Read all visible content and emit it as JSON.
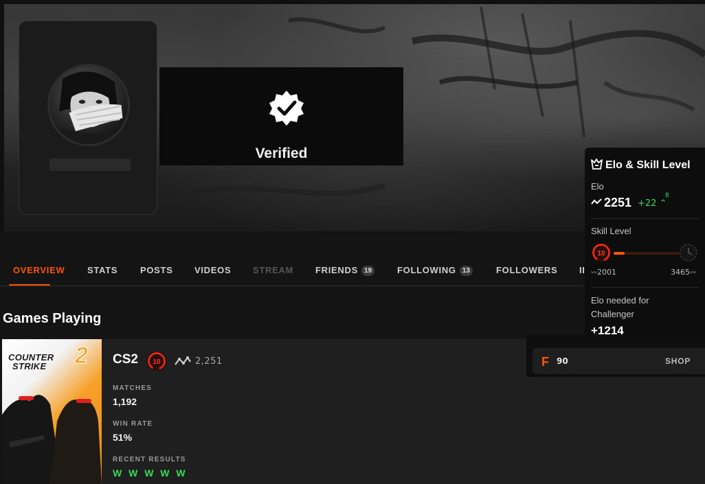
{
  "profile": {
    "verified_label": "Verified",
    "avatar_icon": "user-avatar",
    "verified_icon": "verified-badge-icon"
  },
  "tabs": [
    {
      "label": "OVERVIEW",
      "badge": "",
      "state": "active"
    },
    {
      "label": "STATS",
      "badge": "",
      "state": "normal"
    },
    {
      "label": "POSTS",
      "badge": "",
      "state": "normal"
    },
    {
      "label": "VIDEOS",
      "badge": "",
      "state": "normal"
    },
    {
      "label": "STREAM",
      "badge": "",
      "state": "disabled"
    },
    {
      "label": "FRIENDS",
      "badge": "19",
      "state": "normal"
    },
    {
      "label": "FOLLOWING",
      "badge": "13",
      "state": "normal"
    },
    {
      "label": "FOLLOWERS",
      "badge": "",
      "state": "normal"
    },
    {
      "label": "II",
      "badge": "",
      "state": "normal"
    }
  ],
  "games_section": {
    "title": "Games Playing",
    "game": {
      "art_text_line1": "COUNTER",
      "art_text_line2": "STRIKE",
      "art_text_two": "2",
      "name": "CS2",
      "level": "10",
      "elo": "2,251",
      "stats": [
        {
          "label": "MATCHES",
          "value": "1,192"
        },
        {
          "label": "WIN RATE",
          "value": "51%"
        }
      ],
      "recent_label": "RECENT RESULTS",
      "recent_results": "W W W W W"
    }
  },
  "elo_panel": {
    "title": "Elo & Skill Level",
    "elo_label": "Elo",
    "elo_value": "2251",
    "elo_change": "+22",
    "elo_streak": "8",
    "skill_label": "Skill Level",
    "level": "10",
    "range_low": "2001",
    "range_high": "3465",
    "needed_label_line1": "Elo needed for",
    "needed_label_line2": "Challenger",
    "needed_value": "+1214",
    "progress_fraction": 0.17
  },
  "shop": {
    "points": "90",
    "points_icon": "F",
    "button_label": "SHOP"
  },
  "colors": {
    "accent": "#ff5500",
    "win": "#3ad95a",
    "background": "#141414"
  }
}
